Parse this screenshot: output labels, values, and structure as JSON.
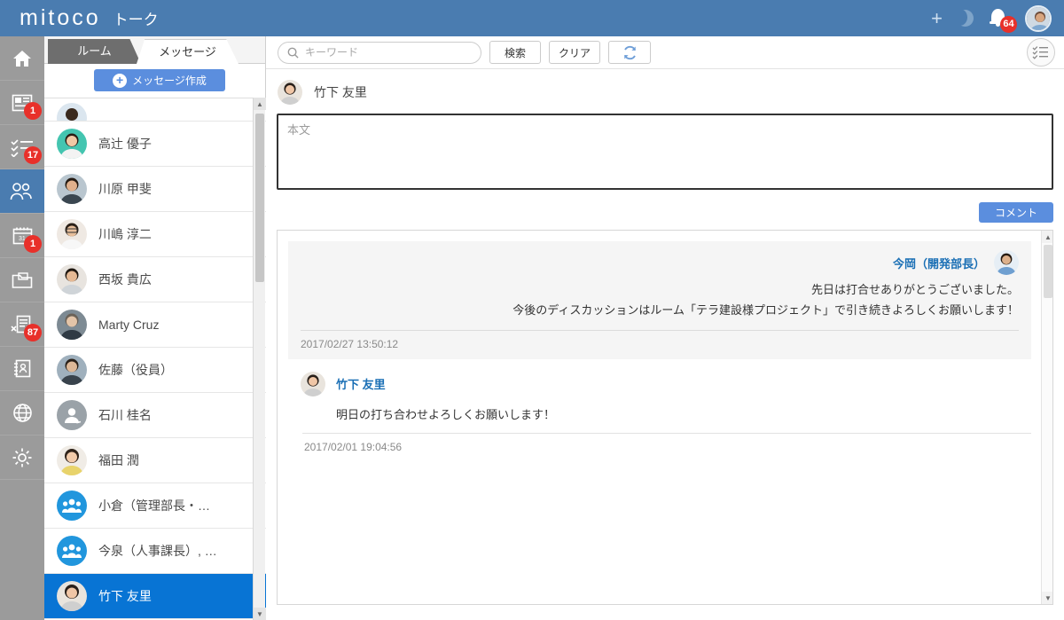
{
  "header": {
    "brand": "mitoco",
    "brand_sub": "トーク",
    "plus_icon": "plus-icon",
    "moon_icon": "moon-icon",
    "bell_icon": "bell-icon",
    "notification_count": "64",
    "avatar_icon": "user-avatar",
    "background_color": "#4a7cb0"
  },
  "rail": {
    "background_color": "#9b9b9b",
    "active_color": "#4a7cb0",
    "badge_color": "#e8302a",
    "items": [
      {
        "name": "home",
        "icon": "home-icon",
        "badge": "",
        "active": false
      },
      {
        "name": "news",
        "icon": "news-board-icon",
        "badge": "1",
        "active": false
      },
      {
        "name": "todo",
        "icon": "checklist-icon",
        "badge": "17",
        "active": false
      },
      {
        "name": "contacts",
        "icon": "people-group-icon",
        "badge": "",
        "active": true
      },
      {
        "name": "calendar",
        "icon": "calendar-icon",
        "badge": "1",
        "active": false
      },
      {
        "name": "inbox",
        "icon": "folder-mail-icon",
        "badge": "",
        "active": false
      },
      {
        "name": "documents",
        "icon": "document-x-icon",
        "badge": "87",
        "active": false
      },
      {
        "name": "addressbook",
        "icon": "address-book-icon",
        "badge": "",
        "active": false
      },
      {
        "name": "web",
        "icon": "globe-icon",
        "badge": "",
        "active": false
      },
      {
        "name": "settings",
        "icon": "gear-icon",
        "badge": "",
        "active": false
      }
    ]
  },
  "list_panel": {
    "tabs": [
      {
        "label": "ルーム",
        "active": false
      },
      {
        "label": "メッセージ",
        "active": true
      }
    ],
    "refresh_icon": "refresh-icon",
    "compose_button": "メッセージ作成",
    "compose_icon": "plus-circle-icon",
    "selected_color": "#0874d4",
    "contacts": [
      {
        "name": "",
        "avatar": "photo",
        "type": "photo",
        "selected": false,
        "clipped": true
      },
      {
        "name": "高辻 優子",
        "avatar": "photo",
        "type": "photo",
        "selected": false,
        "clipped": false
      },
      {
        "name": "川原 甲斐",
        "avatar": "photo",
        "type": "photo",
        "selected": false,
        "clipped": false
      },
      {
        "name": "川嶋 淳二",
        "avatar": "photo",
        "type": "photo",
        "selected": false,
        "clipped": false
      },
      {
        "name": "西坂 貴広",
        "avatar": "photo",
        "type": "photo",
        "selected": false,
        "clipped": false
      },
      {
        "name": "Marty Cruz",
        "avatar": "photo",
        "type": "photo",
        "selected": false,
        "clipped": false
      },
      {
        "name": "佐藤（役員）",
        "avatar": "photo",
        "type": "photo",
        "selected": false,
        "clipped": false
      },
      {
        "name": "石川 桂名",
        "avatar": "user-shared-icon",
        "type": "user-icon",
        "selected": false,
        "clipped": false
      },
      {
        "name": "福田 潤",
        "avatar": "photo",
        "type": "photo",
        "selected": false,
        "clipped": false
      },
      {
        "name": "小倉（管理部長・…",
        "avatar": "group-icon",
        "type": "group-icon",
        "selected": false,
        "clipped": false
      },
      {
        "name": "今泉（人事課長）, …",
        "avatar": "group-icon",
        "type": "group-icon",
        "selected": false,
        "clipped": false
      },
      {
        "name": "竹下 友里",
        "avatar": "photo",
        "type": "photo",
        "selected": true,
        "clipped": false
      }
    ],
    "scrollbar": {
      "up_icon": "scroll-up-arrow",
      "down_icon": "scroll-down-arrow"
    }
  },
  "toolbar": {
    "search_placeholder": "キーワード",
    "search_value": "",
    "search_icon": "search-icon",
    "search_button": "検索",
    "clear_button": "クリア",
    "refresh_icon": "refresh-icon",
    "list_view_icon": "checklist-circle-icon"
  },
  "compose": {
    "recipient": "竹下 友里",
    "avatar_icon": "user-avatar",
    "body_placeholder": "本文",
    "body_value": "",
    "comment_button": "コメント",
    "button_color": "#5b8ede"
  },
  "thread": {
    "messages": [
      {
        "author": "今岡（開発部長）",
        "align": "right",
        "highlighted": true,
        "avatar_icon": "user-avatar",
        "lines": [
          "先日は打合せありがとうございました。",
          "今後のディスカッションはルーム「テラ建設様プロジェクト」で引き続きよろしくお願いします！"
        ],
        "timestamp": "2017/02/27 13:50:12"
      },
      {
        "author": "竹下 友里",
        "align": "left",
        "highlighted": false,
        "avatar_icon": "user-avatar",
        "lines": [
          "明日の打ち合わせよろしくお願いします！"
        ],
        "timestamp": "2017/02/01 19:04:56"
      }
    ],
    "scrollbar": {
      "up_icon": "scroll-up-arrow",
      "down_icon": "scroll-down-arrow"
    }
  }
}
